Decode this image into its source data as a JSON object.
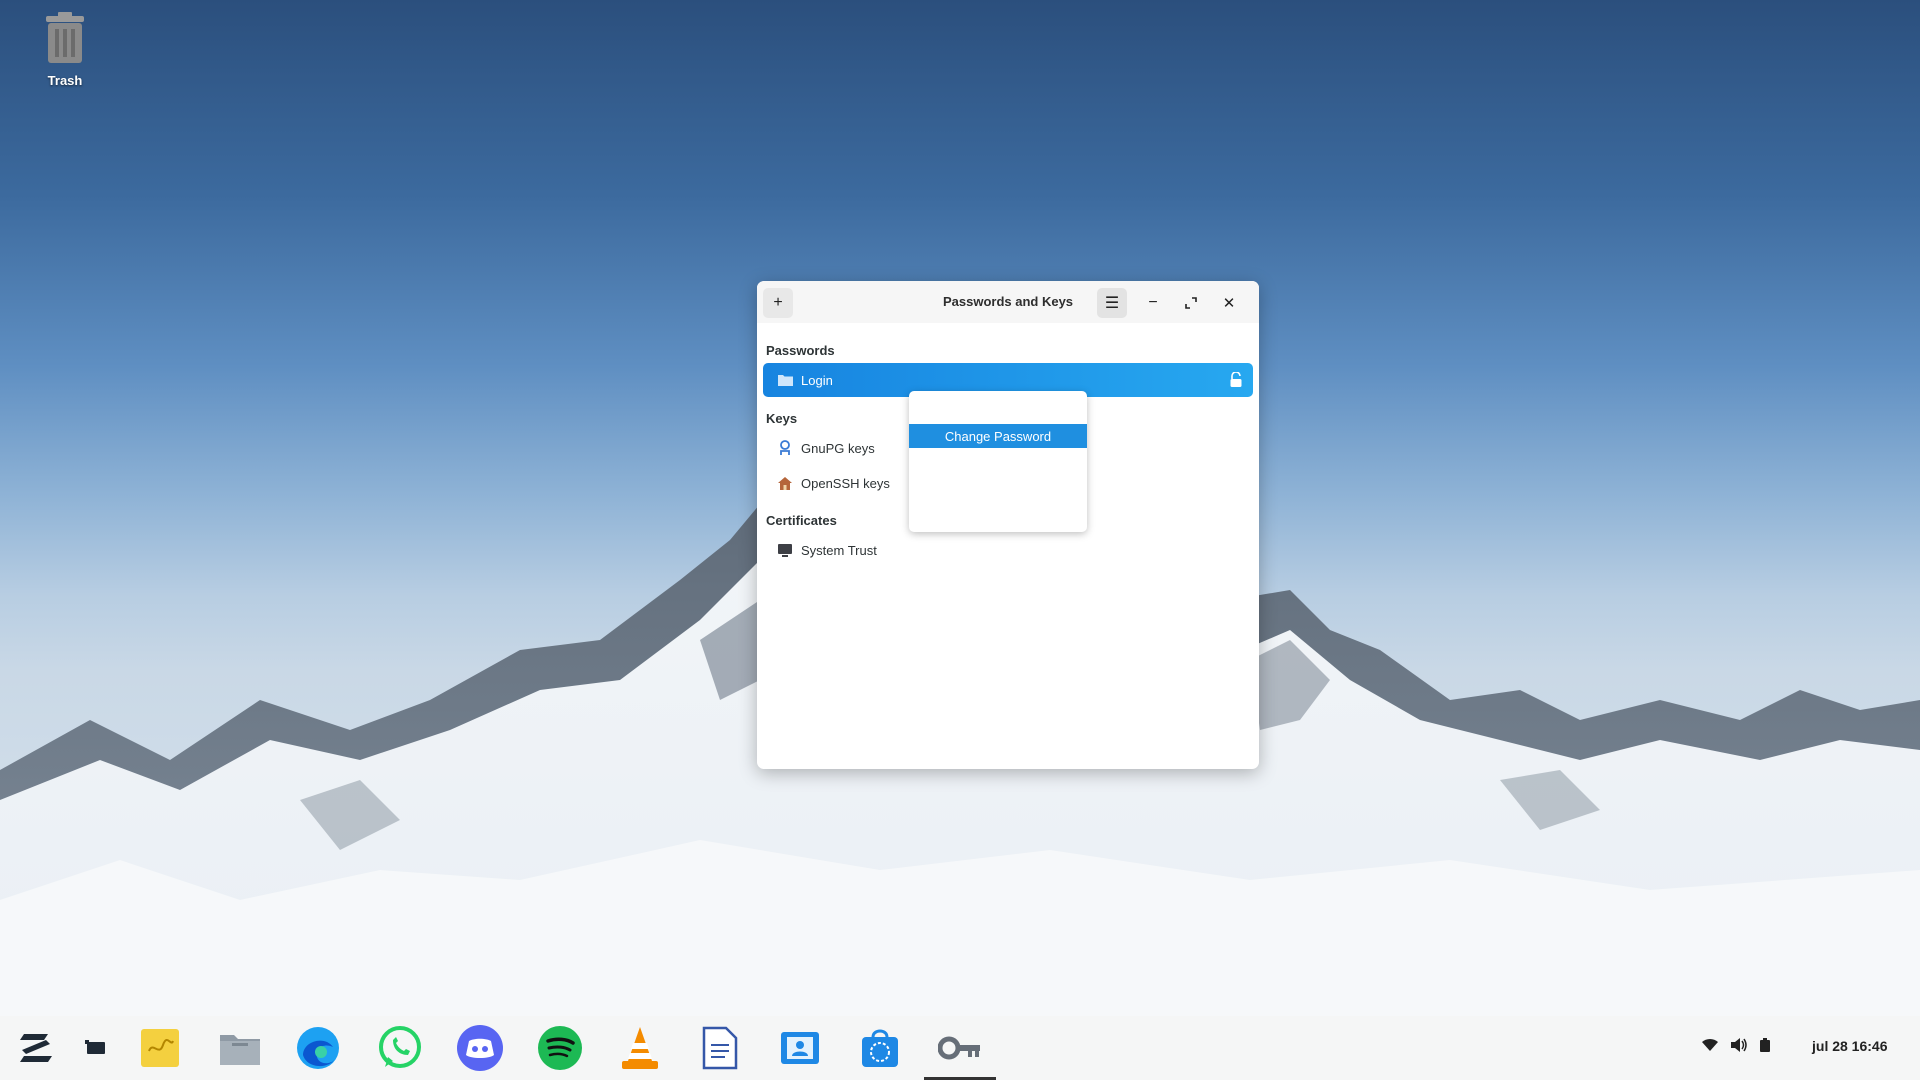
{
  "desktop": {
    "trash_label": "Trash"
  },
  "window": {
    "title": "Passwords and Keys",
    "sections": {
      "passwords": "Passwords",
      "keys": "Keys",
      "certificates": "Certificates"
    },
    "items": {
      "login": "Login",
      "gnupg": "GnuPG keys",
      "openssh": "OpenSSH keys",
      "system_trust": "System Trust"
    }
  },
  "context_menu": {
    "change_password": "Change Password"
  },
  "taskbar": {
    "apps": [
      "zorin-menu-icon",
      "workspace-icon",
      "sticky-notes-icon",
      "files-icon",
      "edge-icon",
      "whatsapp-icon",
      "discord-icon",
      "spotify-icon",
      "vlc-icon",
      "text-editor-icon",
      "contacts-icon",
      "software-store-icon",
      "passwords-keys-icon"
    ],
    "clock": "jul 28  16:46"
  },
  "colors": {
    "accent": "#1c8ee6",
    "window_bg": "#ffffff",
    "taskbar_bg": "#f5f5f5"
  }
}
